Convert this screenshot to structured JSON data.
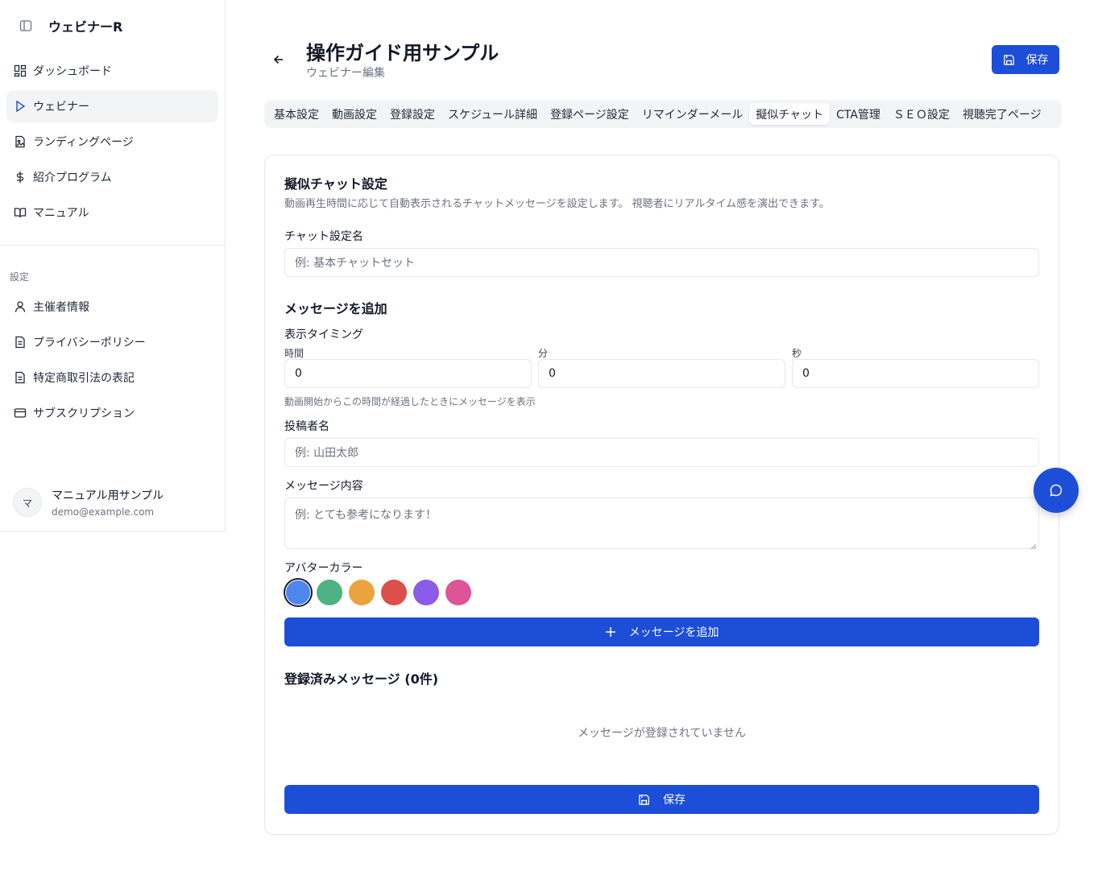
{
  "sidebar": {
    "brand": "ウェビナーR",
    "items": [
      {
        "label": "ダッシュボード",
        "icon": "dashboard-icon"
      },
      {
        "label": "ウェビナー",
        "icon": "play-icon"
      },
      {
        "label": "ランディングページ",
        "icon": "file-image-icon"
      },
      {
        "label": "紹介プログラム",
        "icon": "dollar-icon"
      },
      {
        "label": "マニュアル",
        "icon": "book-icon"
      }
    ],
    "section_label": "設定",
    "settings_items": [
      {
        "label": "主催者情報",
        "icon": "user-icon"
      },
      {
        "label": "プライバシーポリシー",
        "icon": "document-icon"
      },
      {
        "label": "特定商取引法の表記",
        "icon": "document-icon"
      },
      {
        "label": "サブスクリプション",
        "icon": "credit-card-icon"
      }
    ],
    "user": {
      "initial": "マ",
      "name": "マニュアル用サンプル",
      "email": "demo@example.com"
    }
  },
  "header": {
    "title": "操作ガイド用サンプル",
    "subtitle": "ウェビナー編集",
    "save_label": "保存"
  },
  "tabs": [
    {
      "label": "基本設定"
    },
    {
      "label": "動画設定"
    },
    {
      "label": "登録設定"
    },
    {
      "label": "スケジュール詳細"
    },
    {
      "label": "登録ページ設定"
    },
    {
      "label": "リマインダーメール"
    },
    {
      "label": "擬似チャット",
      "active": true
    },
    {
      "label": "CTA管理"
    },
    {
      "label": "ＳＥＯ設定"
    },
    {
      "label": "視聴完了ページ"
    }
  ],
  "form": {
    "title": "擬似チャット設定",
    "description": "動画再生時間に応じて自動表示されるチャットメッセージを設定します。 視聴者にリアルタイム感を演出できます。",
    "chat_name_label": "チャット設定名",
    "chat_name_placeholder": "例: 基本チャットセット",
    "add_section_title": "メッセージを追加",
    "timing_label": "表示タイミング",
    "hours_label": "時間",
    "hours_value": "0",
    "minutes_label": "分",
    "minutes_value": "0",
    "seconds_label": "秒",
    "seconds_value": "0",
    "timing_hint": "動画開始からこの時間が経過したときにメッセージを表示",
    "author_label": "投稿者名",
    "author_placeholder": "例: 山田太郎",
    "message_label": "メッセージ内容",
    "message_placeholder": "例: とても参考になります！",
    "avatar_color_label": "アバターカラー",
    "avatar_colors": [
      "#4f86ec",
      "#4fb282",
      "#eba33f",
      "#dd4f4a",
      "#8a5ce8",
      "#db5597"
    ],
    "add_button_label": "メッセージを追加",
    "registered_title": "登録済みメッセージ (0件)",
    "empty_text": "メッセージが登録されていません",
    "save_label": "保存"
  },
  "colors": {
    "primary": "#1d4ed8"
  }
}
